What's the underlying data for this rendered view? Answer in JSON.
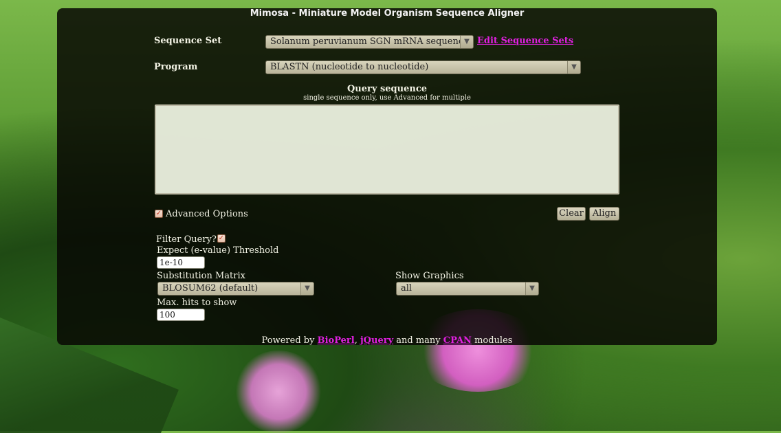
{
  "app": {
    "title": "Mimosa - Miniature Model Organism Sequence Aligner"
  },
  "sequence_set": {
    "label": "Sequence Set",
    "selected": "Solanum peruvianum SGN mRNA sequences",
    "edit_link": "Edit Sequence Sets"
  },
  "program": {
    "label": "Program",
    "selected": "BLASTN (nucleotide to nucleotide)"
  },
  "query": {
    "heading": "Query sequence",
    "subheading": "single sequence only, use Advanced for multiple",
    "value": ""
  },
  "advanced": {
    "label": "Advanced Options",
    "checked": true
  },
  "buttons": {
    "clear": "Clear",
    "align": "Align"
  },
  "options": {
    "filter_label": "Filter Query?:",
    "filter_checked": true,
    "expect_label": "Expect (e-value) Threshold",
    "expect_value": "1e-10",
    "matrix_label": "Substitution Matrix",
    "matrix_selected": "BLOSUM62 (default)",
    "graphics_label": "Show Graphics",
    "graphics_selected": "all",
    "maxhits_label": "Max. hits to show",
    "maxhits_value": "100"
  },
  "footer": {
    "prefix": "Powered by",
    "bioperl": "BioPerl",
    "sep": ",",
    "jquery": "jQuery",
    "middle": "and many",
    "cpan": "CPAN",
    "suffix": "modules"
  },
  "icons": {
    "dropdown": "▼",
    "check": "✓"
  },
  "colors": {
    "link": "#e020e0",
    "panel": "#080804"
  }
}
